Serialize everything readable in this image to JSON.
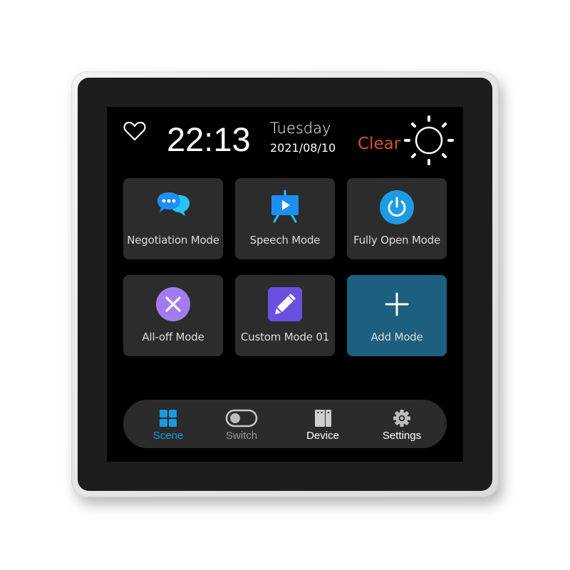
{
  "status_bar": {
    "favorite_icon": "heart-outline-icon",
    "time": "22:13",
    "weekday": "Tuesday",
    "date": "2021/08/10",
    "weather": "Clear",
    "weather_icon": "sun-icon"
  },
  "modes": [
    {
      "label": "Negotiation Mode",
      "icon": "chat-bubbles-icon"
    },
    {
      "label": "Speech Mode",
      "icon": "presentation-board-icon"
    },
    {
      "label": "Fully Open Mode",
      "icon": "power-icon"
    },
    {
      "label": "All-off Mode",
      "icon": "close-circle-icon"
    },
    {
      "label": "Custom Mode 01",
      "icon": "pencil-icon"
    },
    {
      "label": "Add Mode",
      "icon": "plus-icon"
    }
  ],
  "nav": [
    {
      "label": "Scene",
      "icon": "grid-icon",
      "active": true
    },
    {
      "label": "Switch",
      "icon": "toggle-switch-icon",
      "active": false
    },
    {
      "label": "Device",
      "icon": "device-panel-icon",
      "active": false
    },
    {
      "label": "Settings",
      "icon": "gear-icon",
      "active": false
    }
  ],
  "colors": {
    "accent": "#1c9ae0",
    "weather_text": "#d4542f",
    "tile_bg": "#2c2c2c",
    "add_tile_bg": "#1c5f7e",
    "all_off_purple": "#a07cf0",
    "custom_purple": "#6a4fe0"
  }
}
